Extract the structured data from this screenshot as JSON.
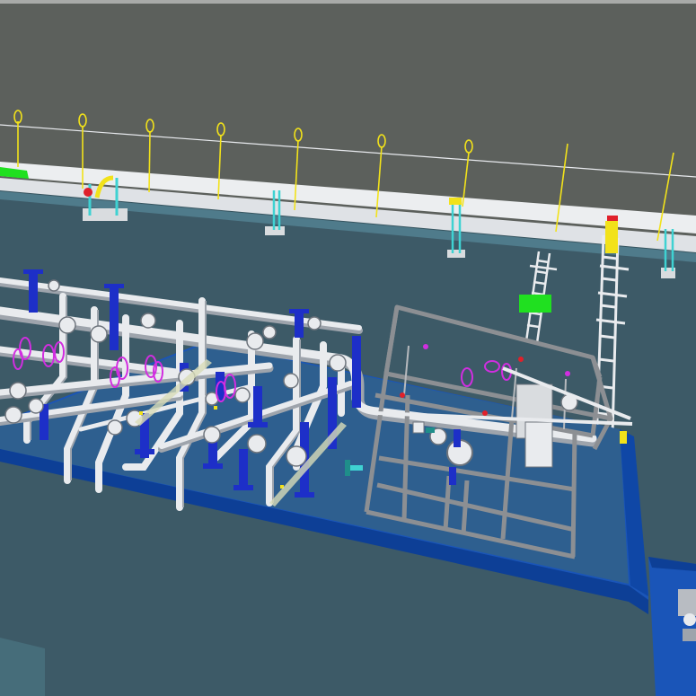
{
  "viewport": {
    "kind": "3D plant model viewport",
    "colors": {
      "sky": "#5c605c",
      "ground": "#3d5a67",
      "ground_far": "#33505d",
      "pad": "#1a55b8",
      "pad_edge": "#0d3f96",
      "pipe": "#e9ebee",
      "pipe_shadow": "#9ea4ac",
      "support": "#1d2fc8",
      "valve_coil": "#d12ee0",
      "frame": "#8c8f93",
      "rack_ladder": "#e9ebee",
      "lamp_pole": "#f2e21a",
      "cyan_stand": "#3fd2d2",
      "green_box": "#20e020",
      "red_marker": "#e0202a"
    }
  }
}
